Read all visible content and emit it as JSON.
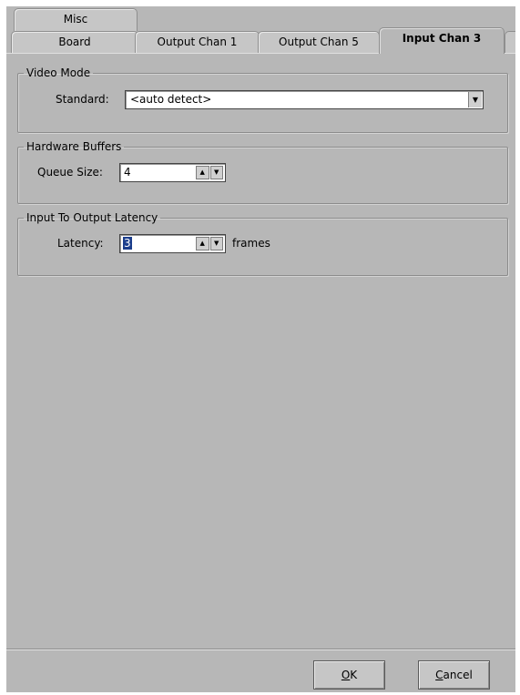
{
  "tabs": {
    "misc": "Misc",
    "board": "Board",
    "output_chan_1": "Output Chan 1",
    "output_chan_5": "Output Chan 5",
    "input_chan_3": "Input Chan 3",
    "active": "Input Chan 3"
  },
  "video_mode": {
    "legend": "Video Mode",
    "standard_label": "Standard:",
    "standard_value": "<auto detect>"
  },
  "hardware_buffers": {
    "legend": "Hardware Buffers",
    "queue_size_label": "Queue Size:",
    "queue_size_value": "4"
  },
  "latency": {
    "legend": "Input To Output Latency",
    "latency_label": "Latency:",
    "latency_value": "3",
    "units": "frames"
  },
  "buttons": {
    "ok_mnemonic": "O",
    "ok_rest": "K",
    "cancel_mnemonic": "C",
    "cancel_rest": "ancel"
  },
  "icons": {
    "dropdown": "chevron-down-icon",
    "spin_up": "arrow-up-icon",
    "spin_down": "arrow-down-icon"
  },
  "colors": {
    "panel_bg": "#b7b7b7",
    "selection": "#1c3e8c"
  }
}
